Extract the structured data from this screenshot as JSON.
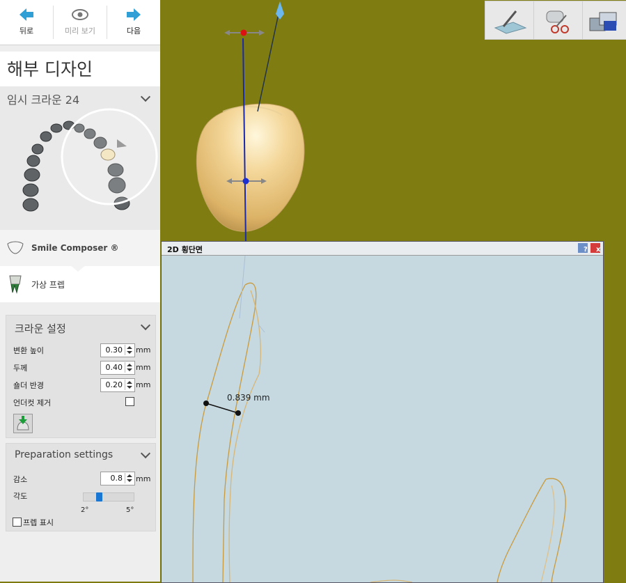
{
  "nav": {
    "back_label": "뒤로",
    "preview_label": "미리 보기",
    "next_label": "다음"
  },
  "page_title": "해부 디자인",
  "crown_selector": {
    "label": "임시 크라운 24"
  },
  "menu": {
    "smile_composer": "Smile Composer ®",
    "virtual_prep": "가상 프렙"
  },
  "crown_settings": {
    "header": "크라운 설정",
    "rows": [
      {
        "label": "변환 높이",
        "value": "0.30",
        "unit": "mm"
      },
      {
        "label": "두께",
        "value": "0.40",
        "unit": "mm"
      },
      {
        "label": "숄더 반경",
        "value": "0.20",
        "unit": "mm"
      }
    ],
    "undercut_label": "언더컷 제거",
    "undercut_checked": false
  },
  "prep_settings": {
    "header": "Preparation settings",
    "reduction_label": "감소",
    "reduction_value": "0.8",
    "reduction_unit": "mm",
    "angle_label": "각도",
    "angle_min": "2°",
    "angle_max": "5°",
    "angle_level": 0.3,
    "show_prep_label": "프렙 표시",
    "show_prep_checked": false
  },
  "toolbar": {
    "icons": [
      "scalpel-plane-icon",
      "scissors-teeth-icon",
      "teeth-blocks-icon"
    ]
  },
  "section_dialog": {
    "title": "2D 횡단면",
    "help_label": "?",
    "close_label": "x",
    "measurement": "0.839 mm"
  },
  "colors": {
    "viewport_bg": "#7f7c12",
    "dialog_bg": "#c6d9e0",
    "contour": "#c99a3c",
    "accent_blue": "#1aa3d9"
  }
}
